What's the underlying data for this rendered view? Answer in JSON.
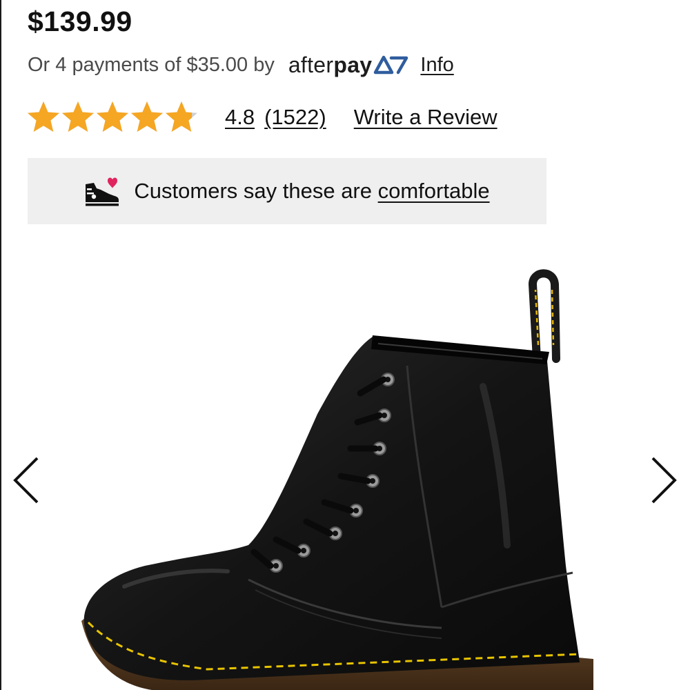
{
  "product": {
    "price": "$139.99"
  },
  "payments": {
    "text": "Or 4 payments of $35.00",
    "by": "by",
    "logo_after": "after",
    "logo_pay": "pay",
    "info_label": "Info"
  },
  "rating": {
    "value": "4.8",
    "count": "(1522)",
    "stars_total": 5,
    "stars_filled": 4.8,
    "star_color": "#f5a623",
    "star_empty_color": "#d0d0d0",
    "write_review_label": "Write a Review"
  },
  "banner": {
    "text_prefix": "Customers say these are ",
    "link_label": "comfortable",
    "icon": "shoe-heart-icon",
    "heart_color": "#e0245e",
    "background": "#efefef"
  },
  "gallery": {
    "prev_icon": "chevron-left-icon",
    "next_icon": "chevron-right-icon",
    "image_subject": "black leather 8-eye lace-up boot with yellow welt stitching"
  },
  "colors": {
    "text": "#111111",
    "muted_text": "#4a4a4a",
    "afterpay_accent": "#2f5d9e"
  }
}
